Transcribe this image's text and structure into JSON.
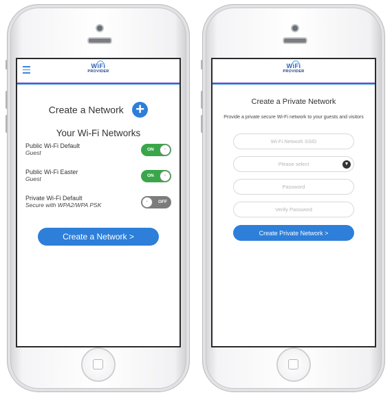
{
  "logo": {
    "top": "WiFi",
    "bottom": "PROVIDER"
  },
  "left_screen": {
    "create_label": "Create a Network",
    "plus_symbol": "+",
    "networks_title": "Your Wi-Fi Networks",
    "networks": [
      {
        "name": "Public Wi-Fi Default",
        "type": "Guest",
        "toggle": "ON",
        "toggle_on": true
      },
      {
        "name": "Public Wi-Fi Easter",
        "type": "Guest",
        "toggle": "ON",
        "toggle_on": true
      },
      {
        "name": "Private Wi-Fi Default",
        "type": "Secure with WPA2/WPA PSK",
        "toggle": "OFF",
        "toggle_on": false
      }
    ],
    "create_button": "Create a Network >"
  },
  "right_screen": {
    "title": "Create a Private Network",
    "description": "Provide a private secure Wi-Fi network to your guests and visitors",
    "ssid_placeholder": "Wi-Fi Network SSID",
    "select_placeholder": "Please select",
    "password_placeholder": "Password",
    "verify_placeholder": "Verify Password",
    "submit_button": "Create Private Network >"
  },
  "colors": {
    "accent": "#2d7fd9",
    "toggle_on": "#3aa64a",
    "toggle_off": "#7c7c7c",
    "header_line": "#6a4ec0"
  }
}
